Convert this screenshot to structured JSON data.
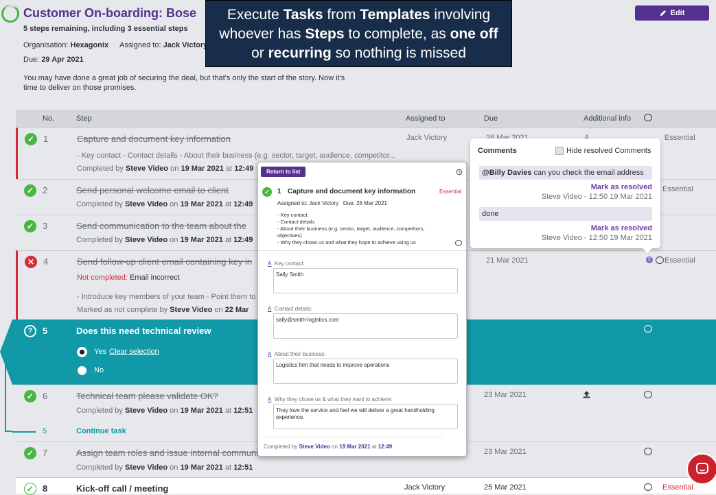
{
  "header": {
    "title": "Customer On-boarding: Bose",
    "steps_remaining": "5 steps remaining, including 3 essential steps",
    "org_label": "Organisation:",
    "org_value": "Hexagonix",
    "assigned_label": "Assigned to:",
    "assigned_value": "Jack Victory",
    "due_label": "Due:",
    "due_value": "29 Apr 2021",
    "description": "You may have done a great job of securing the deal, but that's only the start of the story. Now it's time to deliver on those promises.",
    "edit_label": "Edit"
  },
  "banner": {
    "l1a": "Execute ",
    "l1b": "Tasks",
    "l1c": " from ",
    "l1d": "Templates",
    "l1e": " involving",
    "l2a": "whoever has ",
    "l2b": "Steps",
    "l2c": " to complete, as ",
    "l2d": "one off",
    "l3a": "or ",
    "l3b": "recurring",
    "l3c": " so nothing is missed"
  },
  "table": {
    "col_no": "No.",
    "col_step": "Step",
    "col_assigned": "Assigned to",
    "col_due": "Due",
    "col_info": "Additional info",
    "rows": [
      {
        "num": "1",
        "title": "Capture and document key information",
        "detail": "- Key contact - Contact details - About their business (e.g. sector, target, audience, competitor...",
        "completed_prefix": "Completed by",
        "by": "Steve Video",
        "on": "on",
        "date": "19 Mar 2021",
        "at": "at",
        "time": "12:49",
        "assigned": "Jack Victory",
        "due": "26 Mar 2021",
        "info": "A",
        "badge": "Essential"
      },
      {
        "num": "2",
        "title": "Send personal welcome email to client",
        "completed_prefix": "Completed by",
        "by": "Steve Video",
        "on": "on",
        "date": "19 Mar 2021",
        "at": "at",
        "time": "12:49",
        "badge": "Essential"
      },
      {
        "num": "3",
        "title": "Send communication to the team about the",
        "completed_prefix": "Completed by",
        "by": "Steve Video",
        "on": "on",
        "date": "19 Mar 2021",
        "at": "at",
        "time": "12:49"
      },
      {
        "num": "4",
        "title": "Send follow-up client email containing key in",
        "not_label": "Not completed:",
        "not_reason": "Email incorrect",
        "detail": "- Introduce key members of your team - Point them to",
        "marked_prefix": "Marked as not complete by",
        "by": "Steve Video",
        "on": "on",
        "date": "22 Mar",
        "due": "21 Mar 2021",
        "count": "2",
        "badge": "Essential"
      },
      {
        "num": "5",
        "title": "Does this need technical review",
        "opt_yes": "Yes",
        "clear": "Clear selection",
        "opt_no": "No"
      },
      {
        "num": "6",
        "title": "Technical team please validate OK?",
        "completed_prefix": "Completed by",
        "by": "Steve Video",
        "on": "on",
        "date": "19 Mar 2021",
        "at": "at",
        "time": "12:51",
        "due": "23 Mar 2021"
      },
      {
        "num": "5",
        "title": "Continue task"
      },
      {
        "num": "7",
        "title": "Assign team roles and issue internal communication",
        "completed_prefix": "Completed by",
        "by": "Steve Video",
        "on": "on",
        "date": "19 Mar 2021",
        "at": "at",
        "time": "12:51",
        "due": "23 Mar 2021"
      },
      {
        "num": "8",
        "title": "Kick-off call / meeting",
        "assigned": "Jack Victory",
        "due": "25 Mar 2021",
        "badge": "Essential"
      }
    ]
  },
  "modal": {
    "return_label": "Return to list",
    "step_num": "1",
    "step_title": "Capture and document key information",
    "badge": "Essential",
    "assigned_label": "Assigned to:",
    "assigned_value": "Jack Victory",
    "due_label": "Due:",
    "due_value": "26 Mar 2021",
    "bullets": [
      "- Key contact",
      "- Contact details",
      "- About their business (e.g. sector, target, audience, competitors, objectives)",
      "- Why they chose us and what they hope to achieve using us"
    ],
    "fields": [
      {
        "label": "Key contact:",
        "value": "Sally Smith"
      },
      {
        "label": "Contact details:",
        "value": "sally@smith-logistics.com"
      },
      {
        "label": "About their business:",
        "value": "Logistics firm that needs to improve operations"
      },
      {
        "label": "Why they chose us & what they want to achieve:",
        "value": "They love the service and feel we will deliver a great handholding experience."
      }
    ],
    "completed_prefix": "Completed by",
    "by": "Steve Video",
    "on": "on",
    "date": "19 Mar 2021",
    "at": "at",
    "time": "12:49"
  },
  "comments": {
    "title": "Comments",
    "hide_label": "Hide resolved Comments",
    "items": [
      {
        "mention": "@Billy Davies",
        "text": " can you check the email address",
        "resolve": "Mark as resolved",
        "meta": "Steve Video - 12:50 19 Mar 2021"
      },
      {
        "text": "done",
        "resolve": "Mark as resolved",
        "meta": "Steve Video - 12:50 19 Mar 2021"
      }
    ]
  }
}
